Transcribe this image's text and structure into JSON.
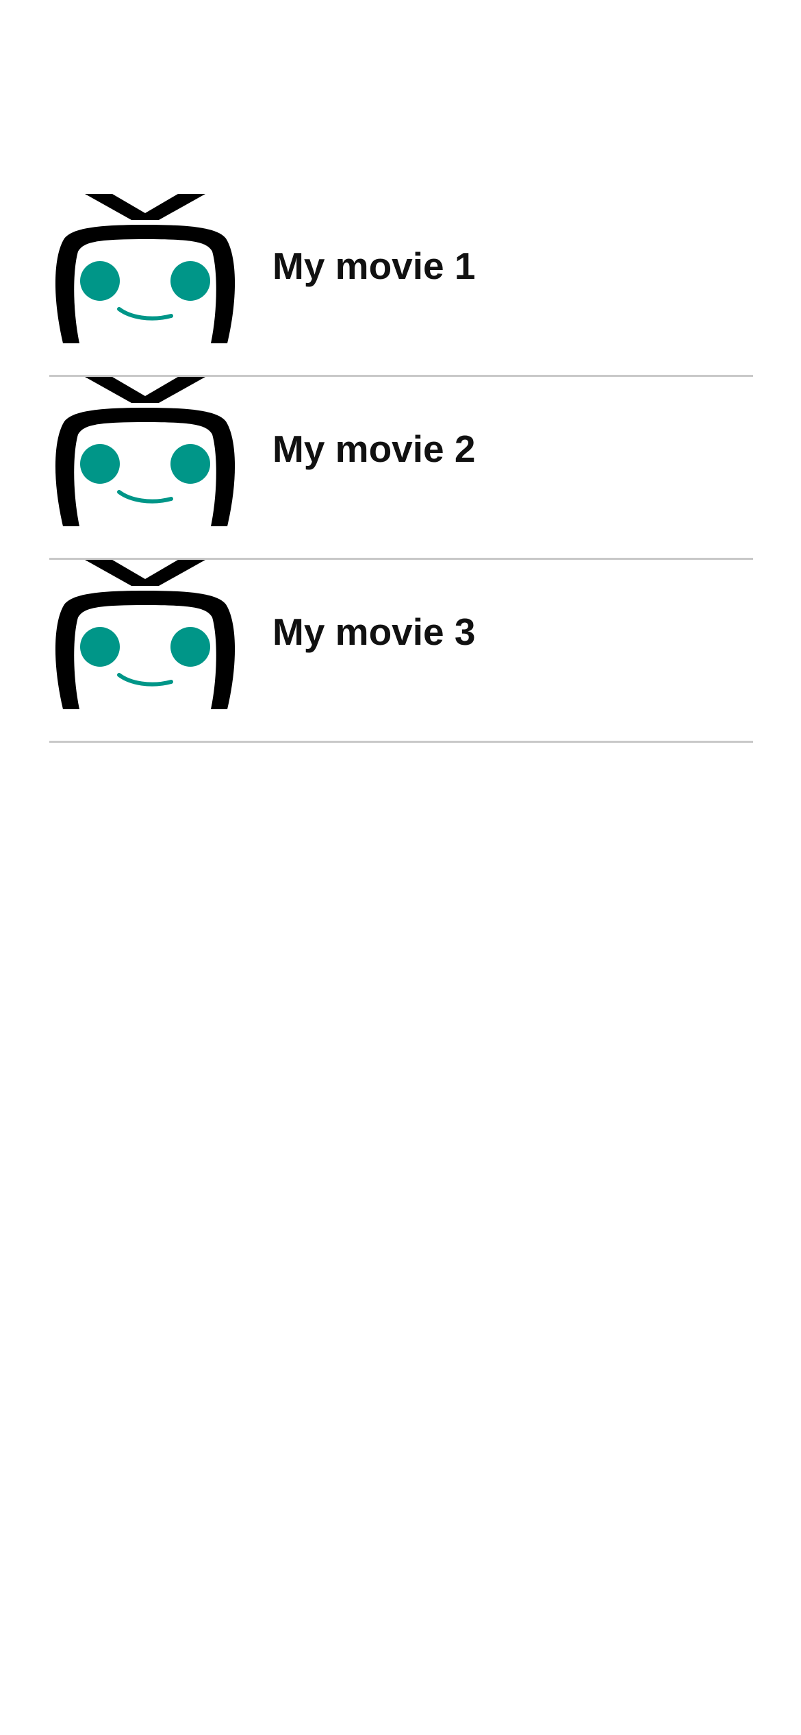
{
  "colors": {
    "background": "#ffffff",
    "divider": "#c8c8c8",
    "title_text": "#111111",
    "logo_outline": "#000000",
    "logo_accent": "#009688"
  },
  "movies": [
    {
      "title": "My movie 1",
      "icon": "tv-mascot-icon"
    },
    {
      "title": "My movie 2",
      "icon": "tv-mascot-icon"
    },
    {
      "title": "My movie 3",
      "icon": "tv-mascot-icon"
    }
  ]
}
